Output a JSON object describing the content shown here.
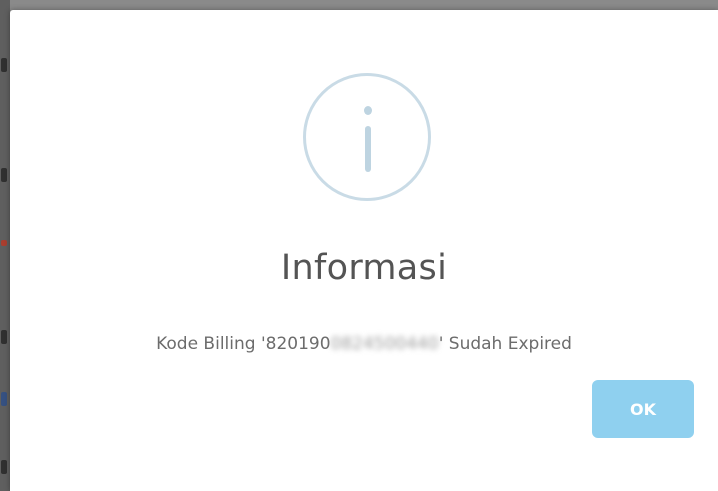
{
  "dialog": {
    "icon": "info-icon",
    "title": "Informasi",
    "message": {
      "prefix": "Kode Billing '820190",
      "masked": "0824500440",
      "suffix": "' Sudah Expired"
    },
    "ok_label": "OK"
  },
  "colors": {
    "backdrop": "#8a8a8a",
    "dialog_background": "#ffffff",
    "icon_stroke": "#c9dbe6",
    "title_text": "#545454",
    "message_text": "#6c6c6c",
    "ok_button": "#8fd0ef",
    "ok_button_text": "#ffffff"
  }
}
